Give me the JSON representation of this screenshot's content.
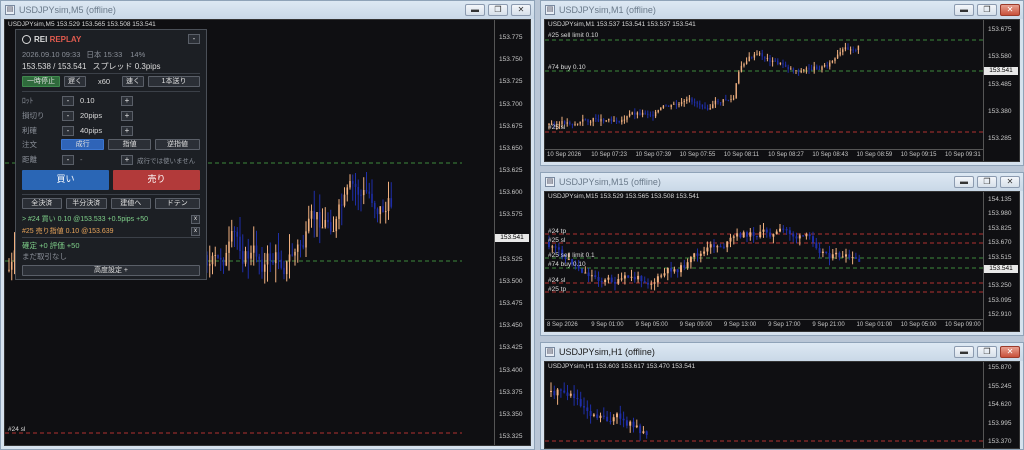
{
  "windows": {
    "m5": {
      "title": "USDJPYsim,M5 (offline)",
      "header": "USDJPYsim,M5  153.529 153.565 153.508 153.541",
      "ticks": [
        "153.775",
        "153.750",
        "153.725",
        "153.700",
        "153.675",
        "153.650",
        "153.625",
        "153.600",
        "153.575",
        "153.550",
        "153.525",
        "153.500",
        "153.475",
        "153.450",
        "153.425",
        "153.400",
        "153.375",
        "153.350",
        "153.325"
      ],
      "price_tag": "153.541",
      "level_labels": [
        "#24 sl"
      ]
    },
    "m1": {
      "title": "USDJPYsim,M1 (offline)",
      "header": "USDJPYsim,M1  153.537 153.541 153.537 153.541",
      "ticks": [
        "153.675",
        "153.580",
        "153.485",
        "153.380",
        "153.285"
      ],
      "price_tag": "153.541",
      "level_labels": [
        "#25 sell limit 0.10",
        "#74 buy 0.10",
        "#25 sl"
      ],
      "xlabels": [
        "10 Sep 2026",
        "10 Sep 07:23",
        "10 Sep 07:39",
        "10 Sep 07:55",
        "10 Sep 08:11",
        "10 Sep 08:27",
        "10 Sep 08:43",
        "10 Sep 08:59",
        "10 Sep 09:15",
        "10 Sep 09:31"
      ]
    },
    "m15": {
      "title": "USDJPYsim,M15 (offline)",
      "header": "USDJPYsim,M15  153.529 153.565 153.508 153.541",
      "ticks": [
        "154.135",
        "153.980",
        "153.825",
        "153.670",
        "153.515",
        "153.405",
        "153.250",
        "153.095",
        "152.910"
      ],
      "price_tag": "153.541",
      "level_labels": [
        "#24 tp",
        "#25 sl",
        "#25 sell limit 0.1",
        "#74 buy 0.10",
        "#24 sl",
        "#25 tp"
      ],
      "xlabels": [
        "8 Sep 2026",
        "9 Sep 01:00",
        "9 Sep 05:00",
        "9 Sep 09:00",
        "9 Sep 13:00",
        "9 Sep 17:00",
        "9 Sep 21:00",
        "10 Sep 01:00",
        "10 Sep 05:00",
        "10 Sep 09:00"
      ]
    },
    "h1": {
      "title": "USDJPYsim,H1 (offline)",
      "header": "USDJPYsim,H1  153.603 153.617 153.470 153.541",
      "ticks": [
        "155.870",
        "155.245",
        "154.620",
        "153.995",
        "153.370"
      ]
    }
  },
  "panel": {
    "brand_a": "REI ",
    "brand_b": "REPLAY",
    "collapse": "-",
    "datetime": "2026.09.10 09:33",
    "jp_time": "日本 15:33",
    "progress": "14%",
    "bid_ask": "153.538 / 153.541",
    "spread": "スプレッド 0.3pips",
    "pause": "一時停止",
    "slow": "遅く",
    "speed": "x60",
    "fast": "速く",
    "step": "1本送り",
    "lot_label": "ﾛｯﾄ",
    "lot_value": "0.10",
    "sl_label": "損切り",
    "sl_value": "20pips",
    "tp_label": "利確",
    "tp_value": "40pips",
    "order_label": "注文",
    "order_market": "成行",
    "order_limit": "指値",
    "order_stop": "逆指値",
    "dist_label": "距離",
    "dist_value": "-",
    "dist_note": "成行では使いません",
    "buy": "買い",
    "sell": "売り",
    "close_all": "全決済",
    "close_half": "半分決済",
    "breakeven": "建値へ",
    "doten": "ドテン",
    "pos1": "> #24 買い 0.10 @153.533  +0.5pips  +50",
    "pos2": "#25 売り指値 0.10 @153.639",
    "x": "x",
    "realized": "確定 +0   評価 +50",
    "no_trades": "まだ取引なし",
    "advanced": "高度設定  +",
    "minus": "-",
    "plus": "+"
  },
  "colors": {
    "up": "#f0b080",
    "down": "#1e2ea8",
    "green_line": "#3c8a3c",
    "red_line": "#b03030"
  }
}
